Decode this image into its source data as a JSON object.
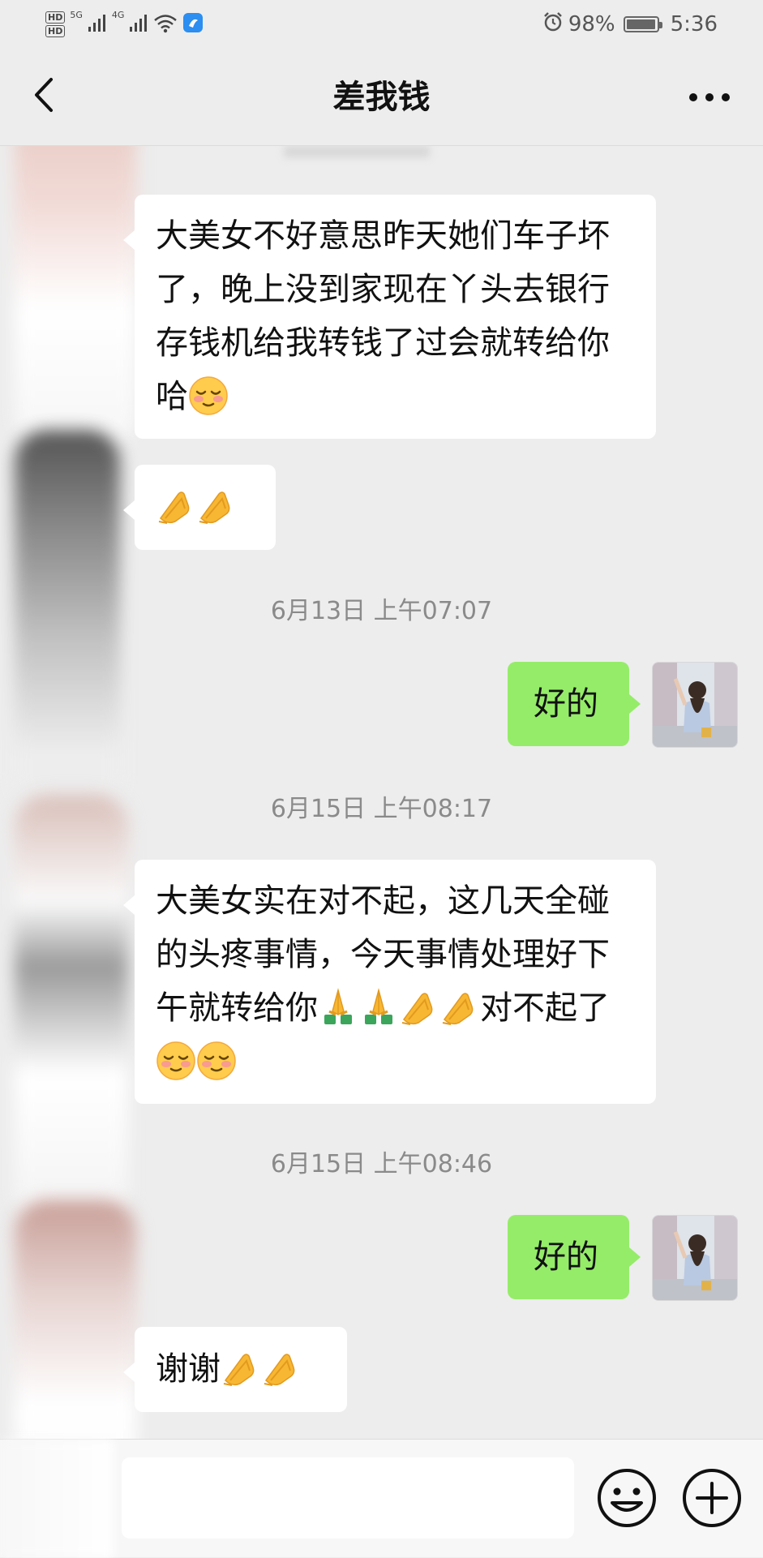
{
  "status_bar": {
    "hd_1": "HD",
    "hd_2": "HD",
    "network_1": "5G",
    "network_2": "4G",
    "battery": "98%",
    "battery_level": 0.98,
    "time": "5:36"
  },
  "header": {
    "title": "差我钱"
  },
  "messages": [
    {
      "side": "left",
      "text": "大美女不好意思昨天她们车子坏了，晚上没到家现在丫头去银行存钱机给我转钱了过会就转给你哈",
      "emoji": [
        "relieved-face"
      ]
    },
    {
      "side": "left",
      "emoji": [
        "pinched-hands",
        "pinched-hands"
      ]
    },
    {
      "type": "timestamp",
      "text": "6月13日 上午07:07"
    },
    {
      "side": "right",
      "text": "好的"
    },
    {
      "type": "timestamp",
      "text": "6月15日 上午08:17"
    },
    {
      "side": "left",
      "text_a": "大美女实在对不起，这几天全碰的头疼事情，今天事情处理好下午就转给你",
      "text_b": "对不起了",
      "emoji": [
        "folded-hands",
        "folded-hands",
        "pinched-hands",
        "pinched-hands",
        "relieved-face",
        "relieved-face"
      ]
    },
    {
      "type": "timestamp",
      "text": "6月15日 上午08:46"
    },
    {
      "side": "right",
      "text": "好的"
    },
    {
      "side": "left",
      "text": "谢谢",
      "emoji": [
        "pinched-hands",
        "pinched-hands"
      ]
    }
  ],
  "colors": {
    "background": "#ededed",
    "bubble_left": "#ffffff",
    "bubble_right": "#95ec69",
    "timestamp": "#8a8a8a"
  },
  "icons": [
    "back-arrow-icon",
    "more-dots-icon",
    "smile-icon",
    "plus-icon",
    "alarm-icon",
    "wifi-icon",
    "signal-icon",
    "battery-icon"
  ]
}
